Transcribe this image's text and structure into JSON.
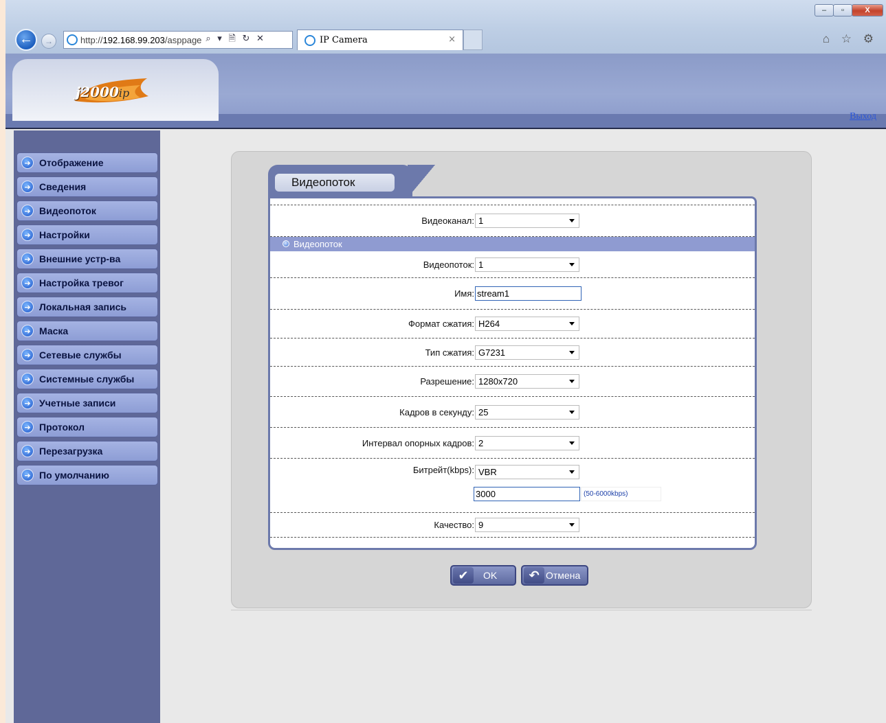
{
  "browser": {
    "url_prefix": "http://",
    "url_host": "192.168.99.203",
    "url_path": "/asppage",
    "tab_title": "IP Camera",
    "addr_tools": "⌕ ▾ 🗎 ↻ ✕",
    "tab_close": "×",
    "window_controls": [
      "–",
      "▫",
      "X"
    ],
    "chrome_icons": "⌂ ☆ ⚙"
  },
  "header": {
    "logo_main": "j2000",
    "logo_suffix": "ip",
    "logout_label": "Выход"
  },
  "sidebar": {
    "items": [
      {
        "label": "Отображение"
      },
      {
        "label": "Сведения"
      },
      {
        "label": "Видеопоток"
      },
      {
        "label": "Настройки"
      },
      {
        "label": "Внешние устр-ва"
      },
      {
        "label": "Настройка тревог"
      },
      {
        "label": "Локальная запись"
      },
      {
        "label": "Маска"
      },
      {
        "label": "Сетевые службы"
      },
      {
        "label": "Системные службы"
      },
      {
        "label": "Учетные записи"
      },
      {
        "label": "Протокол"
      },
      {
        "label": "Перезагрузка"
      },
      {
        "label": "По умолчанию"
      }
    ]
  },
  "form": {
    "tab_title": "Видеопоток",
    "section_title": "Видеопоток",
    "channel": {
      "label": "Видеоканал:",
      "value": "1"
    },
    "stream": {
      "label": "Видеопоток:",
      "value": "1"
    },
    "name": {
      "label": "Имя:",
      "value": "stream1"
    },
    "compression_format": {
      "label": "Формат сжатия:",
      "value": "H264"
    },
    "compression_type": {
      "label": "Тип сжатия:",
      "value": "G7231"
    },
    "resolution": {
      "label": "Разрешение:",
      "value": "1280x720"
    },
    "fps": {
      "label": "Кадров в секунду:",
      "value": "25"
    },
    "keyframe_interval": {
      "label": "Интервал опорных кадров:",
      "value": "2"
    },
    "bitrate": {
      "label": "Битрейт(kbps):",
      "value": "VBR",
      "amount": "3000",
      "hint": "(50-6000kbps)"
    },
    "quality": {
      "label": "Качество:",
      "value": "9"
    }
  },
  "actions": {
    "ok_label": "OK",
    "ok_icon": "✔",
    "cancel_label": "Отмена",
    "cancel_icon": "↶"
  }
}
